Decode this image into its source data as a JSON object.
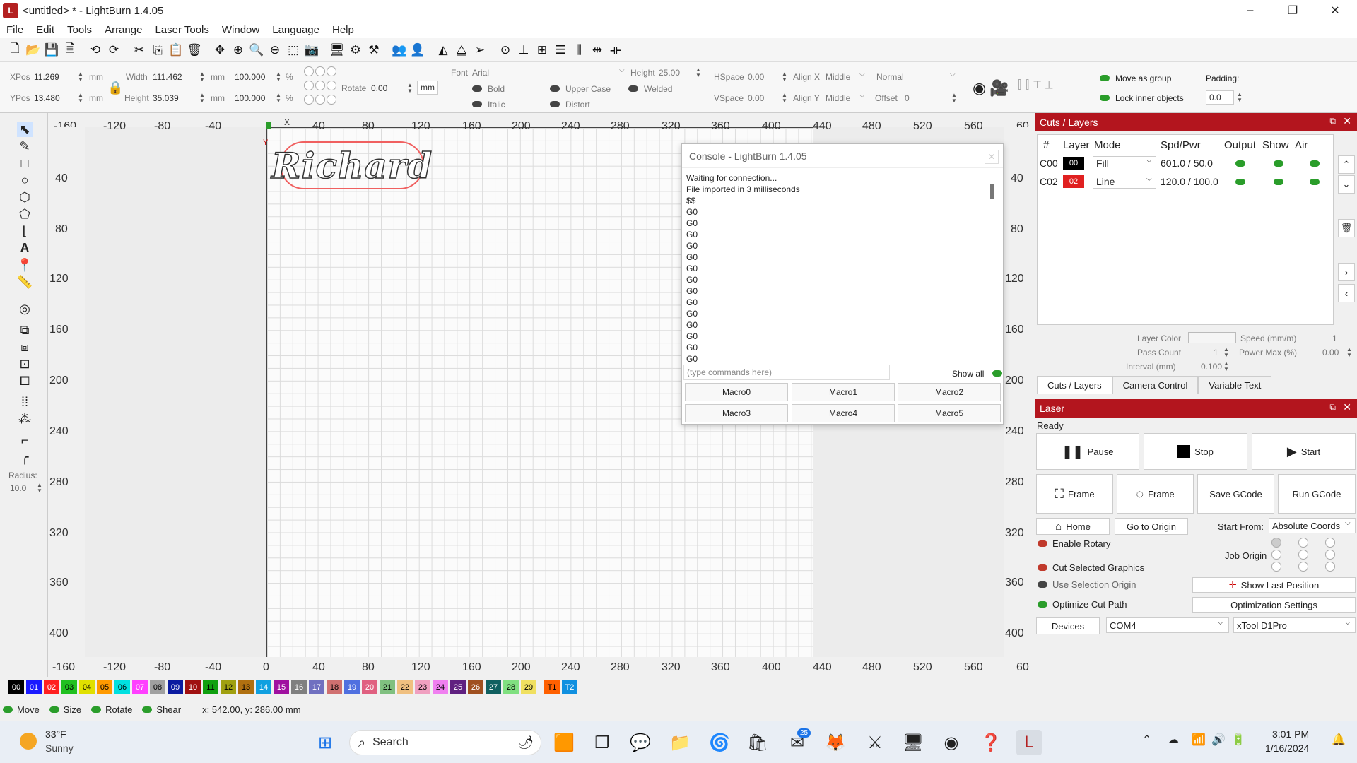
{
  "window": {
    "title": "<untitled> * - LightBurn 1.4.05",
    "logo_letter": "L",
    "controls": [
      "–",
      "❐",
      "✕"
    ]
  },
  "menu": [
    "File",
    "Edit",
    "Tools",
    "Arrange",
    "Laser Tools",
    "Window",
    "Language",
    "Help"
  ],
  "toolbar_icons": [
    "new-file-icon",
    "open-file-icon",
    "save-icon",
    "save-as-icon",
    "undo-icon",
    "redo-icon",
    "cut-icon",
    "copy-icon",
    "paste-icon",
    "delete-icon",
    "move-icon",
    "zoom-in-icon",
    "zoom-out-icon",
    "zoom-fit-icon",
    "zoom-frame-icon",
    "camera-icon",
    "monitor-icon",
    "settings-icon",
    "tools-icon",
    "group-icon",
    "ungroup-icon",
    "mirror-h-icon",
    "mirror-v-icon",
    "send-icon",
    "align-center-icon",
    "align-icon",
    "distribute-icon",
    "distribute-v-icon",
    "dock-icon",
    "center-icon"
  ],
  "transform": {
    "xpos_label": "XPos",
    "xpos": "11.269",
    "ypos_label": "YPos",
    "ypos": "13.480",
    "unit": "mm",
    "width_label": "Width",
    "width": "111.462",
    "height_label": "Height",
    "height": "35.039",
    "scale_w": "100.000",
    "scale_h": "100.000",
    "pct": "%",
    "rotate_label": "Rotate",
    "rotate": "0.00",
    "mm_button": "mm"
  },
  "text_opts": {
    "font_label": "Font",
    "font": "Arial",
    "height_label": "Height",
    "height": "25.00",
    "hspace_label": "HSpace",
    "hspace": "0.00",
    "vspace_label": "VSpace",
    "vspace": "0.00",
    "alignx_label": "Align X",
    "alignx": "Middle",
    "aligny_label": "Align Y",
    "aligny": "Middle",
    "normal": "Normal",
    "offset_label": "Offset",
    "offset": "0",
    "bold": "Bold",
    "italic": "Italic",
    "upper": "Upper Case",
    "distort": "Distort",
    "welded": "Welded"
  },
  "group_opts": {
    "move_as_group": "Move as group",
    "lock_inner": "Lock inner objects",
    "padding_label": "Padding:",
    "padding": "0.0"
  },
  "rulers": {
    "top": [
      "-160",
      "-120",
      "-80",
      "-40",
      "0",
      "40",
      "80",
      "120",
      "160",
      "200",
      "240",
      "280",
      "320",
      "360",
      "400",
      "440",
      "480",
      "520",
      "560",
      "60"
    ],
    "left": [
      "40",
      "80",
      "120",
      "160",
      "200",
      "240",
      "280",
      "320",
      "360",
      "400"
    ],
    "x_label": "X",
    "y_label": "Y"
  },
  "canvas": {
    "text": "Richard"
  },
  "left_tools": {
    "radius_label": "Radius:",
    "radius": "10.0"
  },
  "console": {
    "title": "Console - LightBurn 1.4.05",
    "lines": [
      "Waiting for connection...",
      "File imported in 3 milliseconds",
      "$$",
      "G0",
      "G0",
      "G0",
      "G0",
      "G0",
      "G0",
      "G0",
      "G0",
      "G0",
      "G0",
      "G0",
      "G0",
      "G0",
      "G0"
    ],
    "input_placeholder": "(type commands here)",
    "show_all": "Show all",
    "macros": [
      "Macro0",
      "Macro1",
      "Macro2",
      "Macro3",
      "Macro4",
      "Macro5"
    ]
  },
  "cuts": {
    "title": "Cuts / Layers",
    "headers": [
      "#",
      "Layer",
      "Mode",
      "Spd/Pwr",
      "Output",
      "Show",
      "Air"
    ],
    "rows": [
      {
        "num": "C00",
        "layer": "00",
        "color": "#000000",
        "mode": "Fill",
        "spdpwr": "601.0 / 50.0"
      },
      {
        "num": "C02",
        "layer": "02",
        "color": "#e02020",
        "mode": "Line",
        "spdpwr": "120.0 / 100.0"
      }
    ],
    "layer_color_label": "Layer Color",
    "speed_label": "Speed (mm/m)",
    "speed": "1",
    "pass_label": "Pass Count",
    "pass": "1",
    "power_label": "Power Max (%)",
    "power": "0.00",
    "interval_label": "Interval (mm)",
    "interval": "0.100",
    "tabs": [
      "Cuts / Layers",
      "Camera Control",
      "Variable Text"
    ]
  },
  "laser": {
    "title": "Laser",
    "status": "Ready",
    "pause": "Pause",
    "stop": "Stop",
    "start": "Start",
    "frame1": "Frame",
    "frame2": "Frame",
    "save_gcode": "Save GCode",
    "run_gcode": "Run GCode",
    "home": "Home",
    "go_origin": "Go to Origin",
    "start_from_label": "Start From:",
    "start_from": "Absolute Coords",
    "enable_rotary": "Enable Rotary",
    "job_origin": "Job Origin",
    "cut_selected": "Cut Selected Graphics",
    "use_sel_origin": "Use Selection Origin",
    "show_last": "Show Last Position",
    "optimize": "Optimize Cut Path",
    "opt_settings": "Optimization Settings",
    "devices": "Devices",
    "port": "COM4",
    "device": "xTool D1Pro"
  },
  "palette": [
    {
      "l": "00",
      "c": "#000000",
      "t": "#ffffff"
    },
    {
      "l": "01",
      "c": "#1a1aff",
      "t": "#ffffff"
    },
    {
      "l": "02",
      "c": "#ff2020",
      "t": "#ffffff"
    },
    {
      "l": "03",
      "c": "#20c020",
      "t": "#000000"
    },
    {
      "l": "04",
      "c": "#e0e000",
      "t": "#000000"
    },
    {
      "l": "05",
      "c": "#ff9a00",
      "t": "#000000"
    },
    {
      "l": "06",
      "c": "#00e0e0",
      "t": "#000000"
    },
    {
      "l": "07",
      "c": "#ff40ff",
      "t": "#ffffff"
    },
    {
      "l": "08",
      "c": "#a0a0a0",
      "t": "#000000"
    },
    {
      "l": "09",
      "c": "#0a1aa0",
      "t": "#ffffff"
    },
    {
      "l": "10",
      "c": "#a01010",
      "t": "#ffffff"
    },
    {
      "l": "11",
      "c": "#10a010",
      "t": "#000000"
    },
    {
      "l": "12",
      "c": "#a0a010",
      "t": "#000000"
    },
    {
      "l": "13",
      "c": "#b07010",
      "t": "#000000"
    },
    {
      "l": "14",
      "c": "#10a0e0",
      "t": "#ffffff"
    },
    {
      "l": "15",
      "c": "#a010a0",
      "t": "#ffffff"
    },
    {
      "l": "16",
      "c": "#808080",
      "t": "#ffffff"
    },
    {
      "l": "17",
      "c": "#7070c0",
      "t": "#ffffff"
    },
    {
      "l": "18",
      "c": "#d07070",
      "t": "#000000"
    },
    {
      "l": "19",
      "c": "#5070e0",
      "t": "#ffffff"
    },
    {
      "l": "20",
      "c": "#e06080",
      "t": "#ffffff"
    },
    {
      "l": "21",
      "c": "#80c080",
      "t": "#000000"
    },
    {
      "l": "22",
      "c": "#f0c080",
      "t": "#000000"
    },
    {
      "l": "23",
      "c": "#f0a0c0",
      "t": "#000000"
    },
    {
      "l": "24",
      "c": "#f080f0",
      "t": "#000000"
    },
    {
      "l": "25",
      "c": "#602080",
      "t": "#ffffff"
    },
    {
      "l": "26",
      "c": "#a05020",
      "t": "#ffffff"
    },
    {
      "l": "27",
      "c": "#106060",
      "t": "#ffffff"
    },
    {
      "l": "28",
      "c": "#80e080",
      "t": "#000000"
    },
    {
      "l": "29",
      "c": "#f0e060",
      "t": "#000000"
    },
    {
      "l": "T1",
      "c": "#ff6000",
      "t": "#000000"
    },
    {
      "l": "T2",
      "c": "#1090e0",
      "t": "#ffffff"
    }
  ],
  "status": {
    "move": "Move",
    "size": "Size",
    "rotate": "Rotate",
    "shear": "Shear",
    "coords": "x: 542.00, y: 286.00 mm"
  },
  "taskbar": {
    "temp": "33°F",
    "weather": "Sunny",
    "search": "Search",
    "time": "3:01 PM",
    "date": "1/16/2024",
    "badge": "25"
  }
}
